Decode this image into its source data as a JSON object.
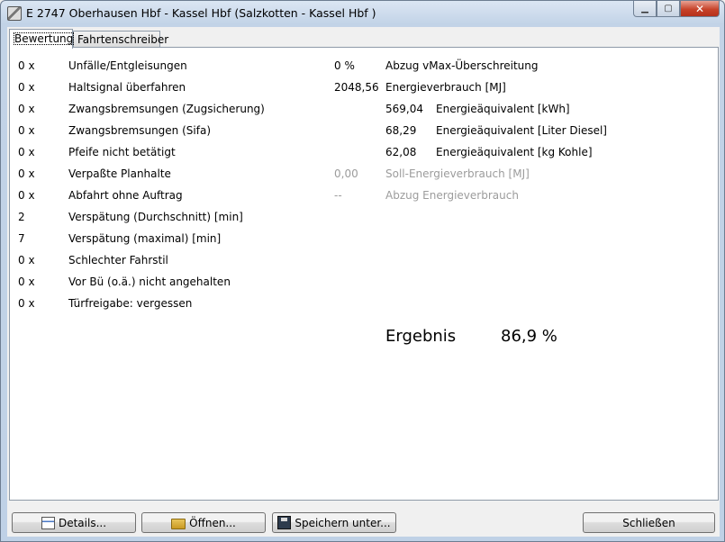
{
  "window": {
    "title": "E 2747 Oberhausen Hbf - Kassel Hbf (Salzkotten - Kassel Hbf )"
  },
  "tabs": [
    {
      "label": "Bewertung",
      "active": true
    },
    {
      "label": "Fahrtenschreiber",
      "active": false
    }
  ],
  "left_rows": [
    {
      "count": "0 x",
      "label": "Unfälle/Entgleisungen"
    },
    {
      "count": "0 x",
      "label": "Haltsignal überfahren"
    },
    {
      "count": "0 x",
      "label": "Zwangsbremsungen (Zugsicherung)"
    },
    {
      "count": "0 x",
      "label": "Zwangsbremsungen (Sifa)"
    },
    {
      "count": "0 x",
      "label": "Pfeife nicht betätigt"
    },
    {
      "count": "0 x",
      "label": "Verpaßte Planhalte"
    },
    {
      "count": "0 x",
      "label": "Abfahrt ohne Auftrag"
    },
    {
      "count": "2",
      "label": "Verspätung (Durchschnitt) [min]"
    },
    {
      "count": "7",
      "label": "Verspätung (maximal) [min]"
    },
    {
      "count": "0 x",
      "label": "Schlechter Fahrstil"
    },
    {
      "count": "0 x",
      "label": "Vor Bü (o.ä.) nicht angehalten"
    },
    {
      "count": "0 x",
      "label": "Türfreigabe: vergessen"
    }
  ],
  "right_rows": {
    "vmax_value": "0 %",
    "vmax_label": "Abzug vMax-Überschreitung",
    "energy_value": "2048,56",
    "energy_label": "Energieverbrauch [MJ]",
    "kwh_value": "569,04",
    "kwh_label": "Energieäquivalent [kWh]",
    "diesel_value": "68,29",
    "diesel_label": "Energieäquivalent [Liter Diesel]",
    "coal_value": "62,08",
    "coal_label": "Energieäquivalent [kg Kohle]",
    "soll_value": "0,00",
    "soll_label": "Soll-Energieverbrauch [MJ]",
    "abzug_value": "--",
    "abzug_label": "Abzug Energieverbrauch"
  },
  "result": {
    "label": "Ergebnis",
    "value": "86,9 %"
  },
  "buttons": {
    "details": "Details...",
    "open": "Öffnen...",
    "save": "Speichern unter...",
    "close": "Schließen"
  },
  "icons": {
    "app": "app-icon",
    "minimize": "minimize-icon",
    "maximize": "maximize-icon",
    "close": "close-icon",
    "details": "details-icon",
    "open": "folder-open-icon",
    "save": "floppy-disk-icon"
  }
}
